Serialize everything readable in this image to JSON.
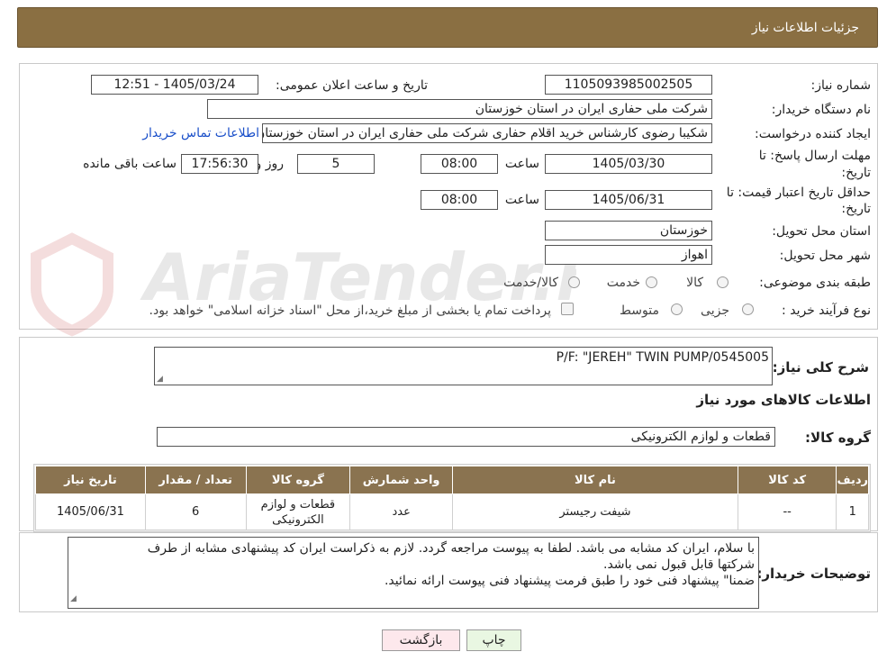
{
  "header": {
    "title": "جزئیات اطلاعات نیاز"
  },
  "form": {
    "need_number_label": "شماره نیاز:",
    "need_number": "1105093985002505",
    "announce_label": "تاریخ و ساعت اعلان عمومی:",
    "announce_value": "1405/03/24 - 12:51",
    "buyer_org_label": "نام دستگاه خریدار:",
    "buyer_org": "شرکت ملی حفاری ایران در استان خوزستان",
    "requester_label": "ایجاد کننده درخواست:",
    "requester": "شکیبا رضوی کارشناس خرید اقلام حفاری شرکت ملی حفاری ایران در استان خوزستان",
    "contact_link": "اطلاعات تماس خریدار",
    "deadline_label_1": "مهلت ارسال پاسخ: تا",
    "deadline_label_2": "تاریخ:",
    "deadline_date": "1405/03/30",
    "time_label": "ساعت",
    "deadline_time": "08:00",
    "days_value": "5",
    "days_label": "روز و",
    "remaining_time": "17:56:30",
    "remaining_label": "ساعت باقی مانده",
    "validity_label_1": "حداقل تاریخ اعتبار قیمت: تا",
    "validity_label_2": "تاریخ:",
    "validity_date": "1405/06/31",
    "validity_time_label": "ساعت",
    "validity_time": "08:00",
    "province_label": "استان محل تحویل:",
    "province": "خوزستان",
    "city_label": "شهر محل تحویل:",
    "city": "اهواز",
    "category_label": "طبقه بندی موضوعی:",
    "category_options": [
      "کالا",
      "خدمت",
      "کالا/خدمت"
    ],
    "process_label": "نوع فرآیند خرید :",
    "process_options": [
      "جزیی",
      "متوسط"
    ],
    "payment_text": "پرداخت تمام یا بخشی از مبلغ خرید،از محل \"اسناد خزانه اسلامی\" خواهد بود."
  },
  "summary": {
    "label": "شرح کلی نیاز:",
    "value": "P/F: \"JEREH\" TWIN PUMP/0545005"
  },
  "goods": {
    "section_title": "اطلاعات کالاهای مورد نیاز",
    "group_label": "گروه کالا:",
    "group_value": "قطعات و لوازم الکترونیکی",
    "columns": [
      "ردیف",
      "کد کالا",
      "نام کالا",
      "واحد شمارش",
      "گروه کالا",
      "تعداد / مقدار",
      "تاریخ نیاز"
    ],
    "rows": [
      [
        "1",
        "--",
        "شیفت رجیستر",
        "عدد",
        "قطعات و لوازم الکترونیکی",
        "6",
        "1405/06/31"
      ]
    ]
  },
  "buyer_notes": {
    "label": "توضیحات خریدار:",
    "lines": [
      "با سلام، ایران کد مشابه می باشد. لطفا به پیوست مراجعه گردد. لازم به ذکراست ایران کد پیشنهادی مشابه از طرف",
      "شرکتها قابل قبول نمی باشد.",
      "ضمنا\" پیشنهاد فنی خود را طبق فرمت پیشنهاد فنی پیوست ارائه نمائید."
    ]
  },
  "buttons": {
    "print": "چاپ",
    "back": "بازگشت"
  },
  "watermark": {
    "text": "AriaTender.neT"
  },
  "colors": {
    "header_bg": "#8a6f42",
    "table_header_bg": "#8a7350",
    "print_btn": "#e9f7e2",
    "back_btn": "#fde8ec",
    "link": "#1a4fc9"
  }
}
